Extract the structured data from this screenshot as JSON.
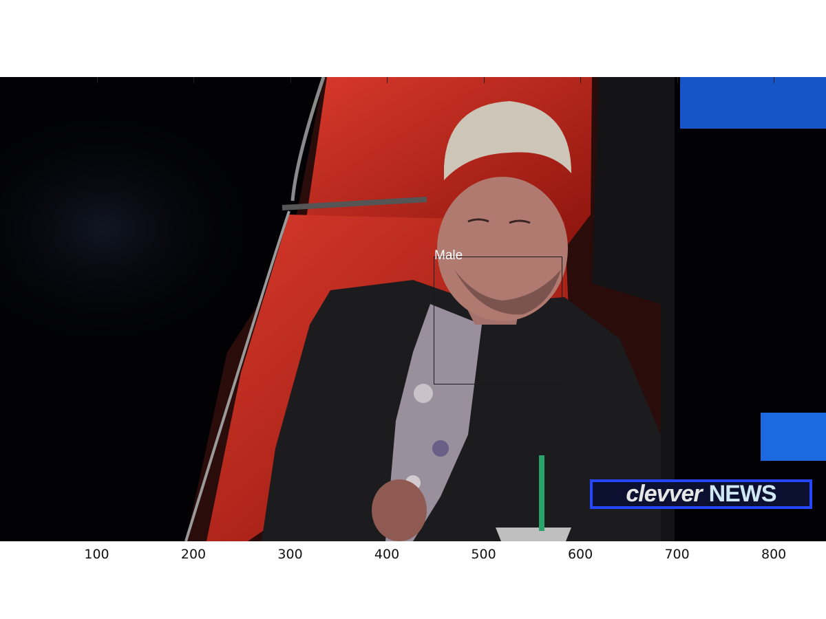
{
  "detection": {
    "label": "Male"
  },
  "logo": {
    "part1": "clevver",
    "part2": "NEWS"
  },
  "x_axis": {
    "ticks": [
      "100",
      "200",
      "300",
      "400",
      "500",
      "600",
      "700",
      "800"
    ]
  },
  "colors": {
    "chair_red": "#c42418",
    "logo_border": "#2446ff",
    "background": "#020204"
  }
}
